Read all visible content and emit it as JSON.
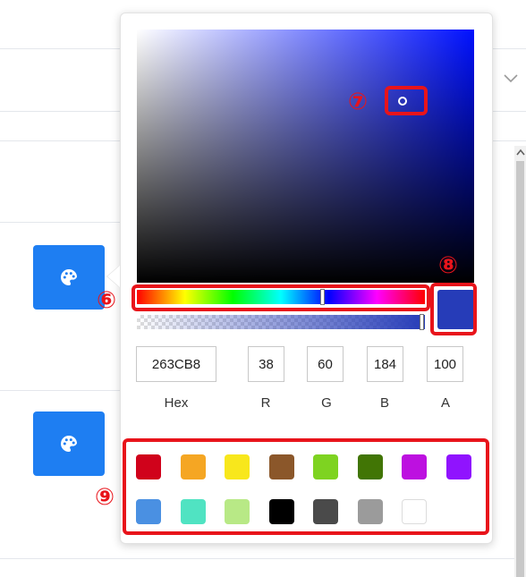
{
  "color": {
    "hex": "263CB8",
    "r": "38",
    "g": "60",
    "b": "184",
    "a": "100",
    "preview": "#263CB8"
  },
  "labels": {
    "hex": "Hex",
    "r": "R",
    "g": "G",
    "b": "B",
    "a": "A"
  },
  "presets": [
    "#d0021b",
    "#f5a623",
    "#f8e71c",
    "#8b572a",
    "#7ed321",
    "#417505",
    "#bd10e0",
    "#9013fe",
    "#4a90e2",
    "#50e3c2",
    "#b8e986",
    "#000000",
    "#4a4a4a",
    "#9b9b9b",
    "#ffffff"
  ],
  "annotations": {
    "hue_slider": "⑥",
    "saturation_handle": "⑦",
    "color_preview": "⑧",
    "preset_swatches": "⑨"
  },
  "icons": {
    "palette_button": "palette-icon",
    "dropdown": "chevron-down-icon",
    "scroll_up": "chevron-up-icon"
  },
  "theme": {
    "accent": "#1e7ef2",
    "annotation": "#e8141b"
  }
}
